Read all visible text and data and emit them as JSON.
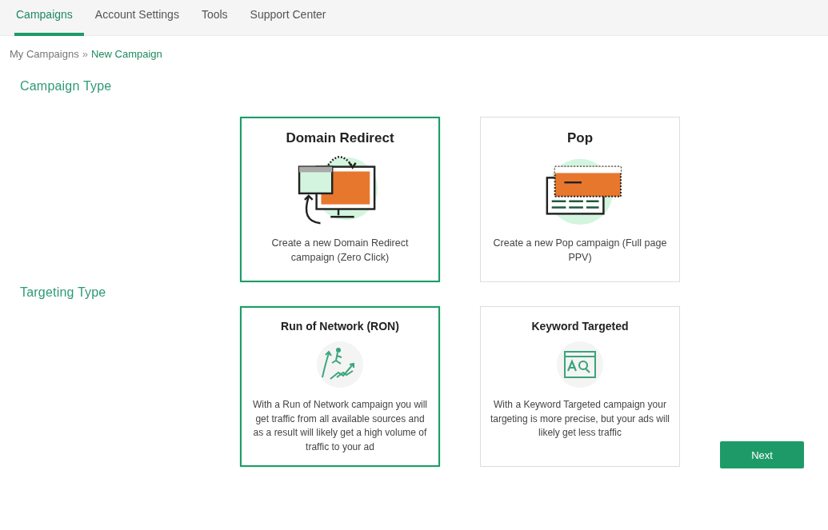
{
  "nav": {
    "tabs": [
      {
        "label": "Campaigns",
        "selected": true
      },
      {
        "label": "Account Settings",
        "selected": false
      },
      {
        "label": "Tools",
        "selected": false
      },
      {
        "label": "Support Center",
        "selected": false
      }
    ]
  },
  "breadcrumb": {
    "parent": "My Campaigns",
    "separator": "»",
    "current": "New Campaign"
  },
  "sections": [
    {
      "title": "Campaign Type",
      "cards": [
        {
          "kind": "domain-redirect",
          "title": "Domain Redirect",
          "description": "Create a new Domain Redirect campaign (Zero Click)",
          "selected": true
        },
        {
          "kind": "pop",
          "title": "Pop",
          "description": "Create a new Pop campaign (Full page PPV)",
          "selected": false
        }
      ]
    },
    {
      "title": "Targeting Type",
      "cards": [
        {
          "kind": "ron",
          "title": "Run of Network (RON)",
          "description": "With a Run of Network campaign you will get traffic from all available sources and as a result will likely get a high volume of traffic to your ad",
          "selected": true
        },
        {
          "kind": "keyword",
          "title": "Keyword Targeted",
          "description": "With a Keyword Targeted campaign your targeting is more precise, but your ads will likely get less traffic",
          "selected": false
        }
      ]
    }
  ],
  "next_button": "Next"
}
